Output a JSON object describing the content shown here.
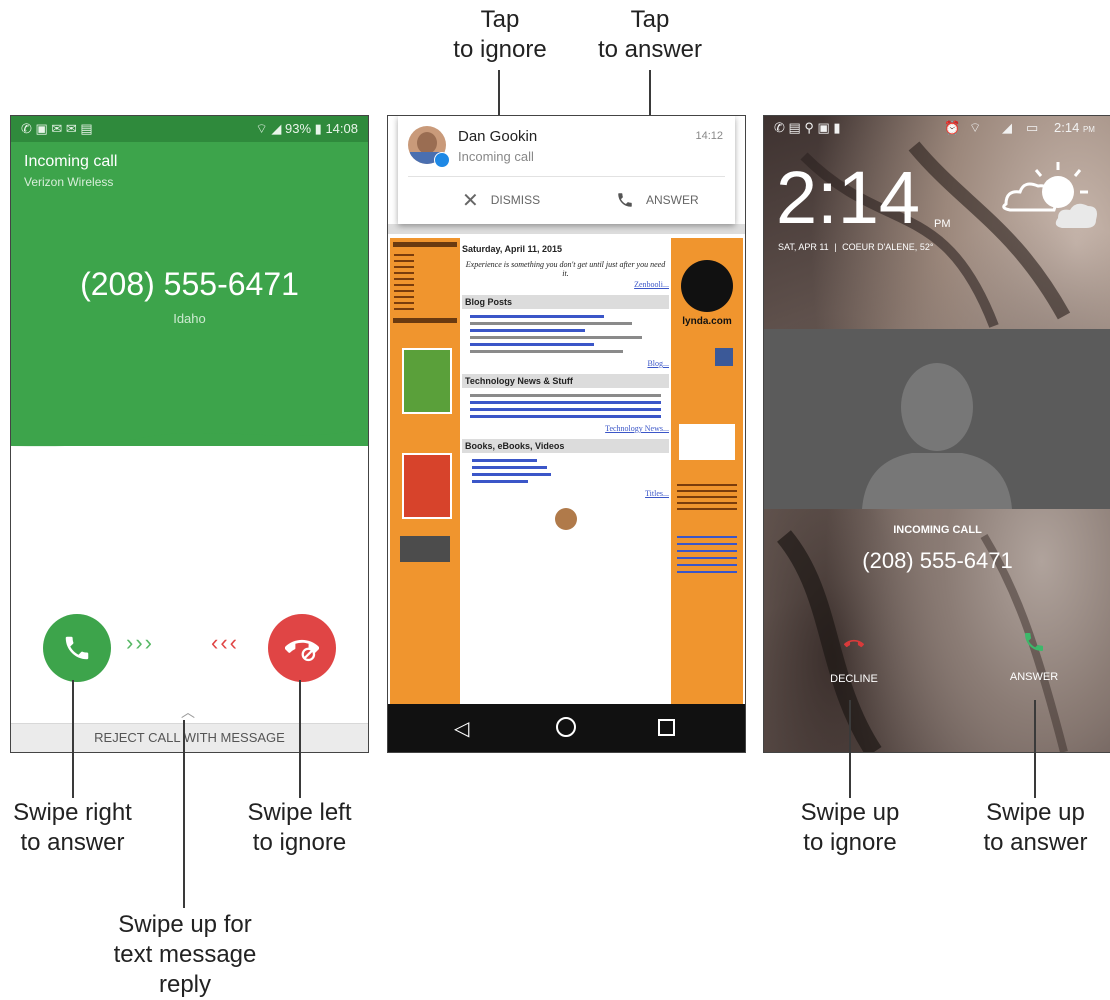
{
  "callouts": {
    "tap_ignore": [
      "Tap",
      "to ignore"
    ],
    "tap_answer": [
      "Tap",
      "to answer"
    ],
    "swipe_right": [
      "Swipe right",
      "to answer"
    ],
    "swipe_left": [
      "Swipe left",
      "to ignore"
    ],
    "swipe_up_text": [
      "Swipe up for",
      "text message reply"
    ],
    "swipe_up_ignore": [
      "Swipe up",
      "to ignore"
    ],
    "swipe_up_answer": [
      "Swipe up",
      "to answer"
    ]
  },
  "phone1": {
    "status": {
      "battery": "93%",
      "time": "14:08"
    },
    "title": "Incoming call",
    "carrier": "Verizon Wireless",
    "number": "(208) 555-6471",
    "location": "Idaho",
    "answer_arrows": "›››",
    "reject_arrows": "‹‹‹",
    "reject_label": "REJECT CALL WITH MESSAGE",
    "colors": {
      "green": "#3da44b",
      "red": "#e04545"
    },
    "icons": [
      "phone-icon",
      "phone-reject-icon",
      "chevron-up-icon"
    ]
  },
  "phone2": {
    "notif": {
      "name": "Dan Gookin",
      "subtitle": "Incoming call",
      "time": "14:12",
      "dismiss": "DISMISS",
      "answer": "ANSWER"
    },
    "web": {
      "date": "Saturday, April 11, 2015",
      "quote": "Experience is something you don't get until just after you need it.",
      "quote_link": "Zenbooli...",
      "blog_header": "Blog Posts",
      "blog_more": "Blog...",
      "tech_header": "Technology News & Stuff",
      "tech_more": "Technology News...",
      "books_header": "Books, eBooks, Videos",
      "books_more": "Titles...",
      "lynda": "lynda.com"
    },
    "nav_icons": [
      "back-icon",
      "home-icon",
      "recents-icon"
    ]
  },
  "phone3": {
    "status_time": "2:14",
    "status_ampm": "PM",
    "clock": "2:14",
    "clock_ampm": "PM",
    "date_line": "SAT, APR 11",
    "weather_line": "COEUR D'ALENE, 52°",
    "incoming": "INCOMING CALL",
    "number": "(208) 555-6471",
    "decline": "DECLINE",
    "answer": "ANSWER",
    "colors": {
      "decline": "#d93a3a",
      "answer": "#3db86a"
    }
  }
}
